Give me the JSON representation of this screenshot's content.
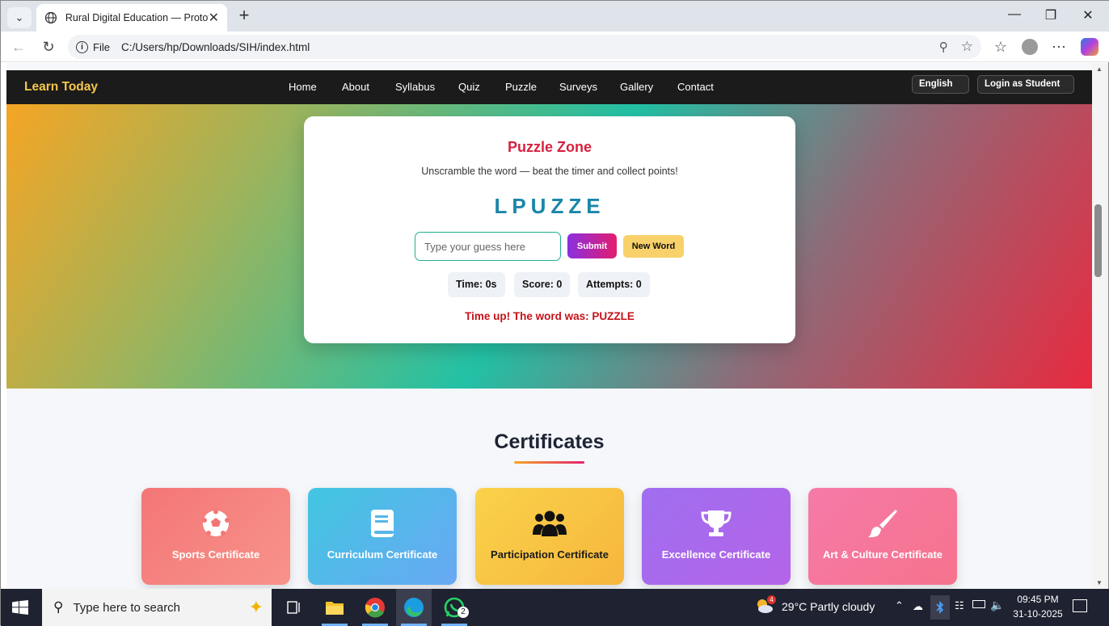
{
  "browser": {
    "tab_title": "Rural Digital Education — Prototype",
    "address_scheme": "File",
    "address_url": "C:/Users/hp/Downloads/SIH/index.html"
  },
  "site": {
    "brand": "Learn Today",
    "nav": [
      "Home",
      "About",
      "Syllabus",
      "Quiz",
      "Puzzle",
      "Surveys",
      "Gallery",
      "Contact"
    ],
    "language": "English",
    "login": "Login as Student"
  },
  "puzzle": {
    "title": "Puzzle Zone",
    "subtitle": "Unscramble the word — beat the timer and collect points!",
    "scrambled": "LPUZZE",
    "placeholder": "Type your guess here",
    "submit": "Submit",
    "new_word": "New Word",
    "time": "Time: 0s",
    "score": "Score: 0",
    "attempts": "Attempts: 0",
    "message": "Time up! The word was: PUZZLE"
  },
  "certificates": {
    "title": "Certificates",
    "items": [
      {
        "label": "Sports Certificate",
        "icon": "soccer-ball-icon"
      },
      {
        "label": "Curriculum Certificate",
        "icon": "book-icon"
      },
      {
        "label": "Participation Certificate",
        "icon": "users-icon"
      },
      {
        "label": "Excellence Certificate",
        "icon": "trophy-icon"
      },
      {
        "label": "Art & Culture Certificate",
        "icon": "paintbrush-icon"
      }
    ]
  },
  "taskbar": {
    "search_placeholder": "Type here to search",
    "weather": "29°C  Partly cloudy",
    "weather_badge": "4",
    "whatsapp_badge": "2",
    "time": "09:45 PM",
    "date": "31-10-2025"
  }
}
